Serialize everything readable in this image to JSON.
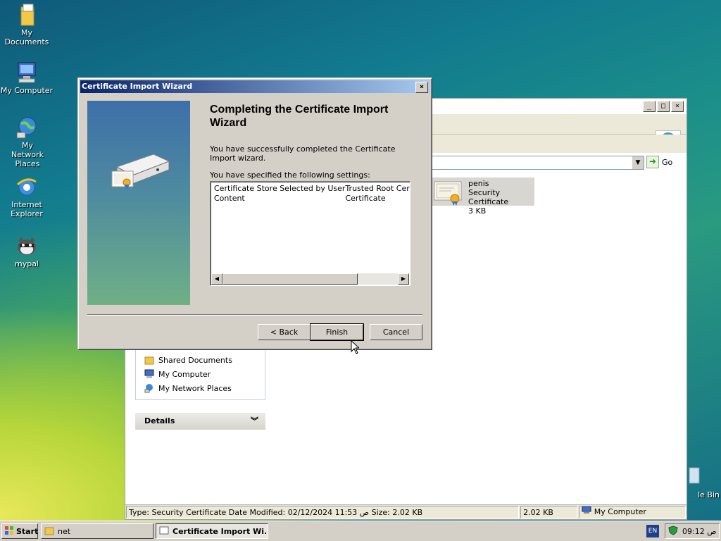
{
  "desktop": {
    "icons": [
      {
        "label": "My Documents"
      },
      {
        "label": "My Computer"
      },
      {
        "label": "My Network Places"
      },
      {
        "label": "Internet Explorer"
      },
      {
        "label": "mypal"
      },
      {
        "label": "Recycle Bin",
        "visible_text": "le Bin"
      }
    ]
  },
  "explorer": {
    "go_label": "Go",
    "file": {
      "name": "penis",
      "type": "Security Certificate",
      "size": "3 KB"
    },
    "other_places": {
      "items": [
        {
          "label": "Shared Documents",
          "icon": "folder-icon"
        },
        {
          "label": "My Computer",
          "icon": "computer-icon"
        },
        {
          "label": "My Network Places",
          "icon": "network-icon"
        }
      ]
    },
    "details": {
      "label": "Details"
    },
    "status": {
      "info": "Type: Security Certificate Date Modified: 02/12/2024 11:53 ص Size: 2.02 KB",
      "size": "2.02 KB",
      "zone": "My Computer"
    }
  },
  "wizard": {
    "title": "Certificate Import Wizard",
    "heading": "Completing the Certificate Import Wizard",
    "success_text": "You have successfully completed the Certificate Import wizard.",
    "settings_intro": "You have specified the following settings:",
    "settings": [
      {
        "name": "Certificate Store Selected by User",
        "value": "Trusted Root Certification Authorities"
      },
      {
        "name": "Content",
        "value": "Certificate"
      }
    ],
    "buttons": {
      "back": "< Back",
      "finish": "Finish",
      "cancel": "Cancel"
    }
  },
  "taskbar": {
    "start": "Start",
    "tasks": [
      {
        "label": "net",
        "active": false
      },
      {
        "label": "Certificate Import Wi...",
        "active": true
      }
    ],
    "language": "EN",
    "clock": "09:12 ص"
  }
}
